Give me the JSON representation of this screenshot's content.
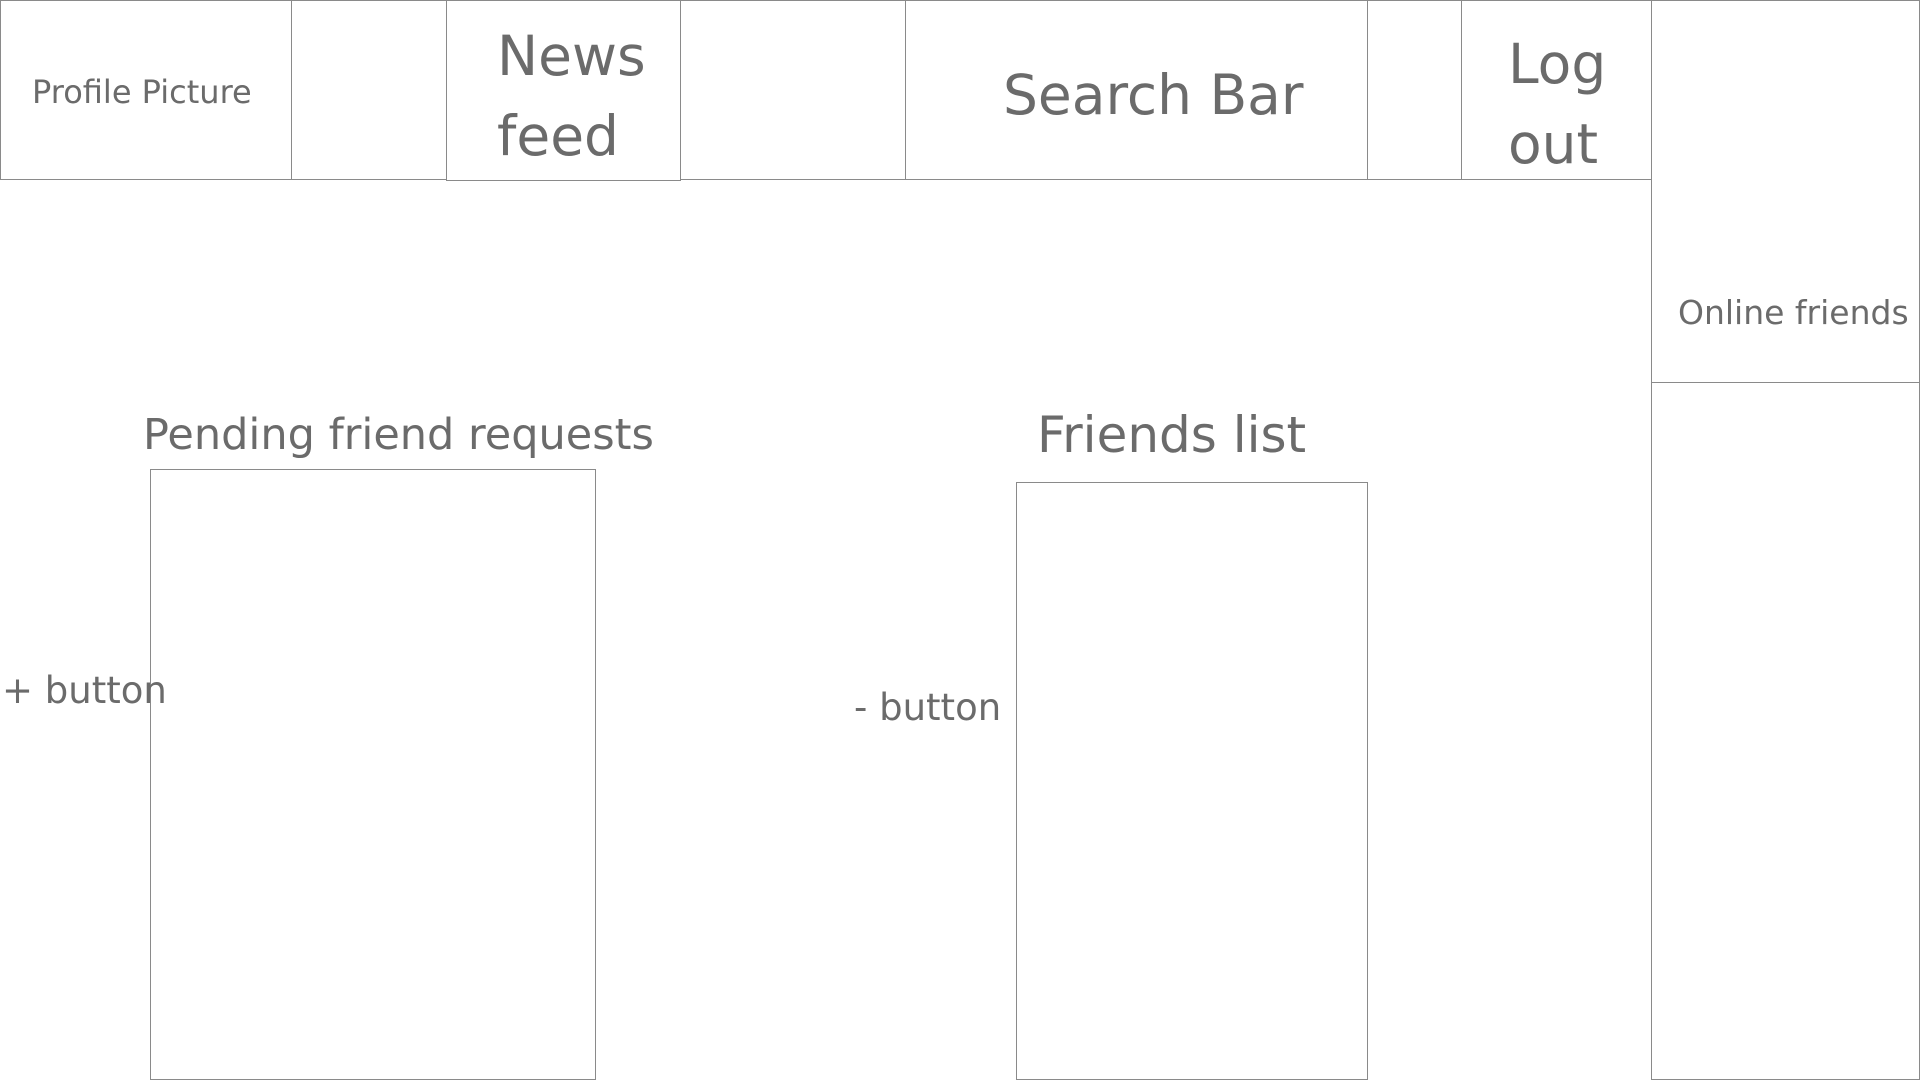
{
  "header": {
    "profile_picture": "Profile Picture",
    "news_feed": "News feed",
    "search_bar": "Search Bar",
    "log_out": "Log out"
  },
  "sidebar": {
    "online_friends": "Online friends"
  },
  "pending_requests": {
    "title": "Pending friend requests",
    "add_button": "+ button"
  },
  "friends": {
    "title": "Friends list",
    "remove_button": "- button"
  }
}
